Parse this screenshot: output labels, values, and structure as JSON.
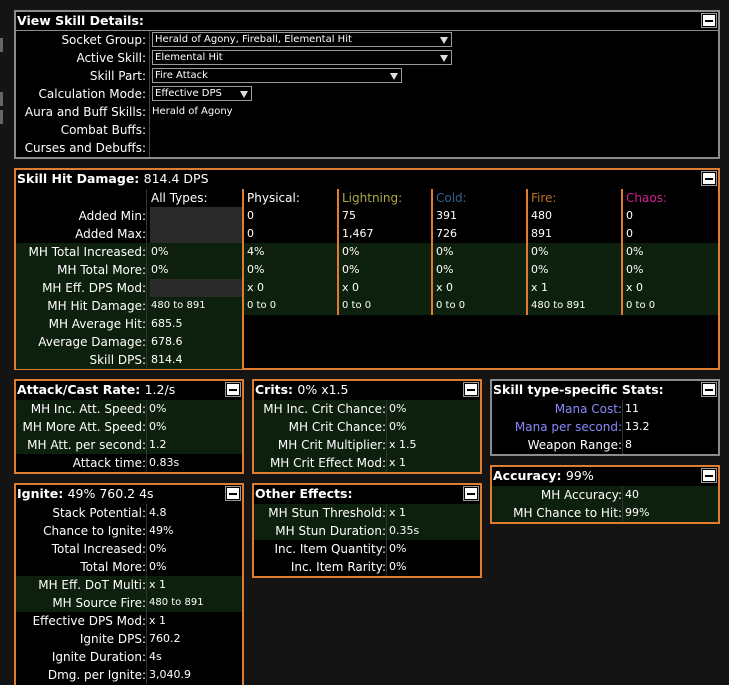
{
  "view_skill": {
    "title": "View Skill Details:",
    "rows": [
      {
        "label": "Socket Group:",
        "value": "Herald of Agony, Fireball, Elemental Hit",
        "kind": "select"
      },
      {
        "label": "Active Skill:",
        "value": "Elemental Hit",
        "kind": "select"
      },
      {
        "label": "Skill Part:",
        "value": "Fire Attack",
        "kind": "select"
      },
      {
        "label": "Calculation Mode:",
        "value": "Effective DPS",
        "kind": "select"
      },
      {
        "label": "Aura and Buff Skills:",
        "value": "Herald of Agony",
        "kind": "text"
      },
      {
        "label": "Combat Buffs:",
        "value": "",
        "kind": "text"
      },
      {
        "label": "Curses and Debuffs:",
        "value": "",
        "kind": "text"
      }
    ]
  },
  "hit": {
    "title": "Skill Hit Damage:",
    "value": "814.4 DPS",
    "columns": [
      {
        "name": "All Types:",
        "color": "#ffffff"
      },
      {
        "name": "Physical:",
        "color": "#ffffff"
      },
      {
        "name": "Lightning:",
        "color": "#adaa47"
      },
      {
        "name": "Cold:",
        "color": "#366492"
      },
      {
        "name": "Fire:",
        "color": "#b97123"
      },
      {
        "name": "Chaos:",
        "color": "#d02090"
      }
    ],
    "rows": [
      {
        "label": "Added Min:",
        "cells": [
          "",
          "0",
          "75",
          "391",
          "480",
          "0"
        ]
      },
      {
        "label": "Added Max:",
        "cells": [
          "",
          "0",
          "1,467",
          "726",
          "891",
          "0"
        ]
      },
      {
        "label": "MH Total Increased:",
        "cells": [
          "0%",
          "4%",
          "0%",
          "0%",
          "0%",
          "0%"
        ]
      },
      {
        "label": "MH Total More:",
        "cells": [
          "0%",
          "0%",
          "0%",
          "0%",
          "0%",
          "0%"
        ]
      },
      {
        "label": "MH Eff. DPS Mod:",
        "cells": [
          "",
          "x 0",
          "x 0",
          "x 0",
          "x 1",
          "x 0"
        ]
      },
      {
        "label": "MH Hit Damage:",
        "cells": [
          "480 to 891",
          "0 to 0",
          "0 to 0",
          "0 to 0",
          "480 to 891",
          "0 to 0"
        ]
      },
      {
        "label": "MH Average Hit:",
        "cells": [
          "685.5"
        ]
      },
      {
        "label": "Average Damage:",
        "cells": [
          "678.6"
        ]
      },
      {
        "label": "Skill DPS:",
        "cells": [
          "814.4"
        ]
      }
    ]
  },
  "attack": {
    "title": "Attack/Cast Rate:",
    "value": "1.2/s",
    "rows": [
      {
        "label": "MH Inc. Att. Speed:",
        "value": "0%"
      },
      {
        "label": "MH More Att. Speed:",
        "value": "0%"
      },
      {
        "label": "MH Att. per second:",
        "value": "1.2"
      },
      {
        "label": "Attack time:",
        "value": "0.83s"
      }
    ]
  },
  "crits": {
    "title": "Crits:",
    "value": "0% x1.5",
    "rows": [
      {
        "label": "MH Inc. Crit Chance:",
        "value": "0%"
      },
      {
        "label": "MH Crit Chance:",
        "value": "0%"
      },
      {
        "label": "MH Crit Multiplier:",
        "value": "x 1.5"
      },
      {
        "label": "MH Crit Effect Mod:",
        "value": "x 1"
      }
    ]
  },
  "skilltype": {
    "title": "Skill type-specific Stats:",
    "rows": [
      {
        "label": "Mana Cost:",
        "value": "11"
      },
      {
        "label": "Mana per second:",
        "value": "13.2"
      },
      {
        "label": "Weapon Range:",
        "value": "8"
      }
    ]
  },
  "accuracy": {
    "title": "Accuracy:",
    "value": "99%",
    "rows": [
      {
        "label": "MH Accuracy:",
        "value": "40"
      },
      {
        "label": "MH Chance to Hit:",
        "value": "99%"
      }
    ]
  },
  "ignite": {
    "title": "Ignite:",
    "value": "49% 760.2 4s",
    "rows": [
      {
        "label": "Stack Potential:",
        "value": "4.8"
      },
      {
        "label": "Chance to Ignite:",
        "value": "49%"
      },
      {
        "label": "Total Increased:",
        "value": "0%"
      },
      {
        "label": "Total More:",
        "value": "0%"
      },
      {
        "label": "MH Eff. DoT Multi:",
        "value": "x 1"
      },
      {
        "label": "MH Source Fire:",
        "value": "480 to 891"
      },
      {
        "label": "Effective DPS Mod:",
        "value": "x 1"
      },
      {
        "label": "Ignite DPS:",
        "value": "760.2"
      },
      {
        "label": "Ignite Duration:",
        "value": "4s"
      },
      {
        "label": "Dmg. per Ignite:",
        "value": "3,040.9"
      }
    ]
  },
  "other": {
    "title": "Other Effects:",
    "rows": [
      {
        "label": "MH Stun Threshold:",
        "value": "x 1"
      },
      {
        "label": "MH Stun Duration:",
        "value": "0.35s"
      },
      {
        "label": "Inc. Item Quantity:",
        "value": "0%"
      },
      {
        "label": "Inc. Item Rarity:",
        "value": "0%"
      }
    ]
  },
  "colors": {
    "accent": "#e07c2e",
    "gray_border": "#8c8c8c",
    "highlight": "#0d1f0d",
    "mana": "#8a8aff"
  },
  "icons": {
    "collapse": "minus-box-icon",
    "dropdown": "chevron-down-icon"
  }
}
